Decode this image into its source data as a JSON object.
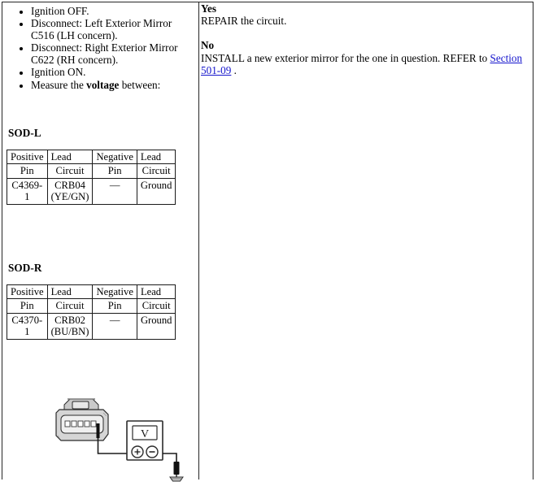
{
  "layout": {
    "columns": 2,
    "border_color": "#262626"
  },
  "left": {
    "steps": [
      {
        "text": "Ignition OFF."
      },
      {
        "text": "Disconnect: Left Exterior Mirror C516 (LH concern)."
      },
      {
        "text": "Disconnect: Right Exterior Mirror C622 (RH concern)."
      },
      {
        "text": "Ignition ON."
      },
      {
        "text_before": "Measure the ",
        "bold": "voltage",
        "text_after": " between:"
      }
    ],
    "tables": [
      {
        "title": "SOD-L",
        "group_headers": [
          "Positive",
          "Lead",
          "Negative",
          "Lead"
        ],
        "column_headers": [
          "Pin",
          "Circuit",
          "Pin",
          "Circuit"
        ],
        "row": [
          "C4369-1",
          "CRB04 (YE/GN)",
          "—",
          "Ground"
        ]
      },
      {
        "title": "SOD-R",
        "group_headers": [
          "Positive",
          "Lead",
          "Negative",
          "Lead"
        ],
        "column_headers": [
          "Pin",
          "Circuit",
          "Pin",
          "Circuit"
        ],
        "row": [
          "C4370-1",
          "CRB02 (BU/BN)",
          "—",
          "Ground"
        ]
      }
    ],
    "diagram": {
      "name": "connector-to-voltmeter-to-ground",
      "meter_display": "V",
      "positive_terminal": "+",
      "negative_terminal": "−"
    }
  },
  "right": {
    "yes_label": "Yes",
    "yes_text": "REPAIR the circuit.",
    "no_label": "No",
    "no_text_before": "INSTALL a new exterior mirror for the one in question. REFER to ",
    "no_link": "Section 501-09",
    "no_text_after": " .",
    "link_color": "#1414cc"
  }
}
